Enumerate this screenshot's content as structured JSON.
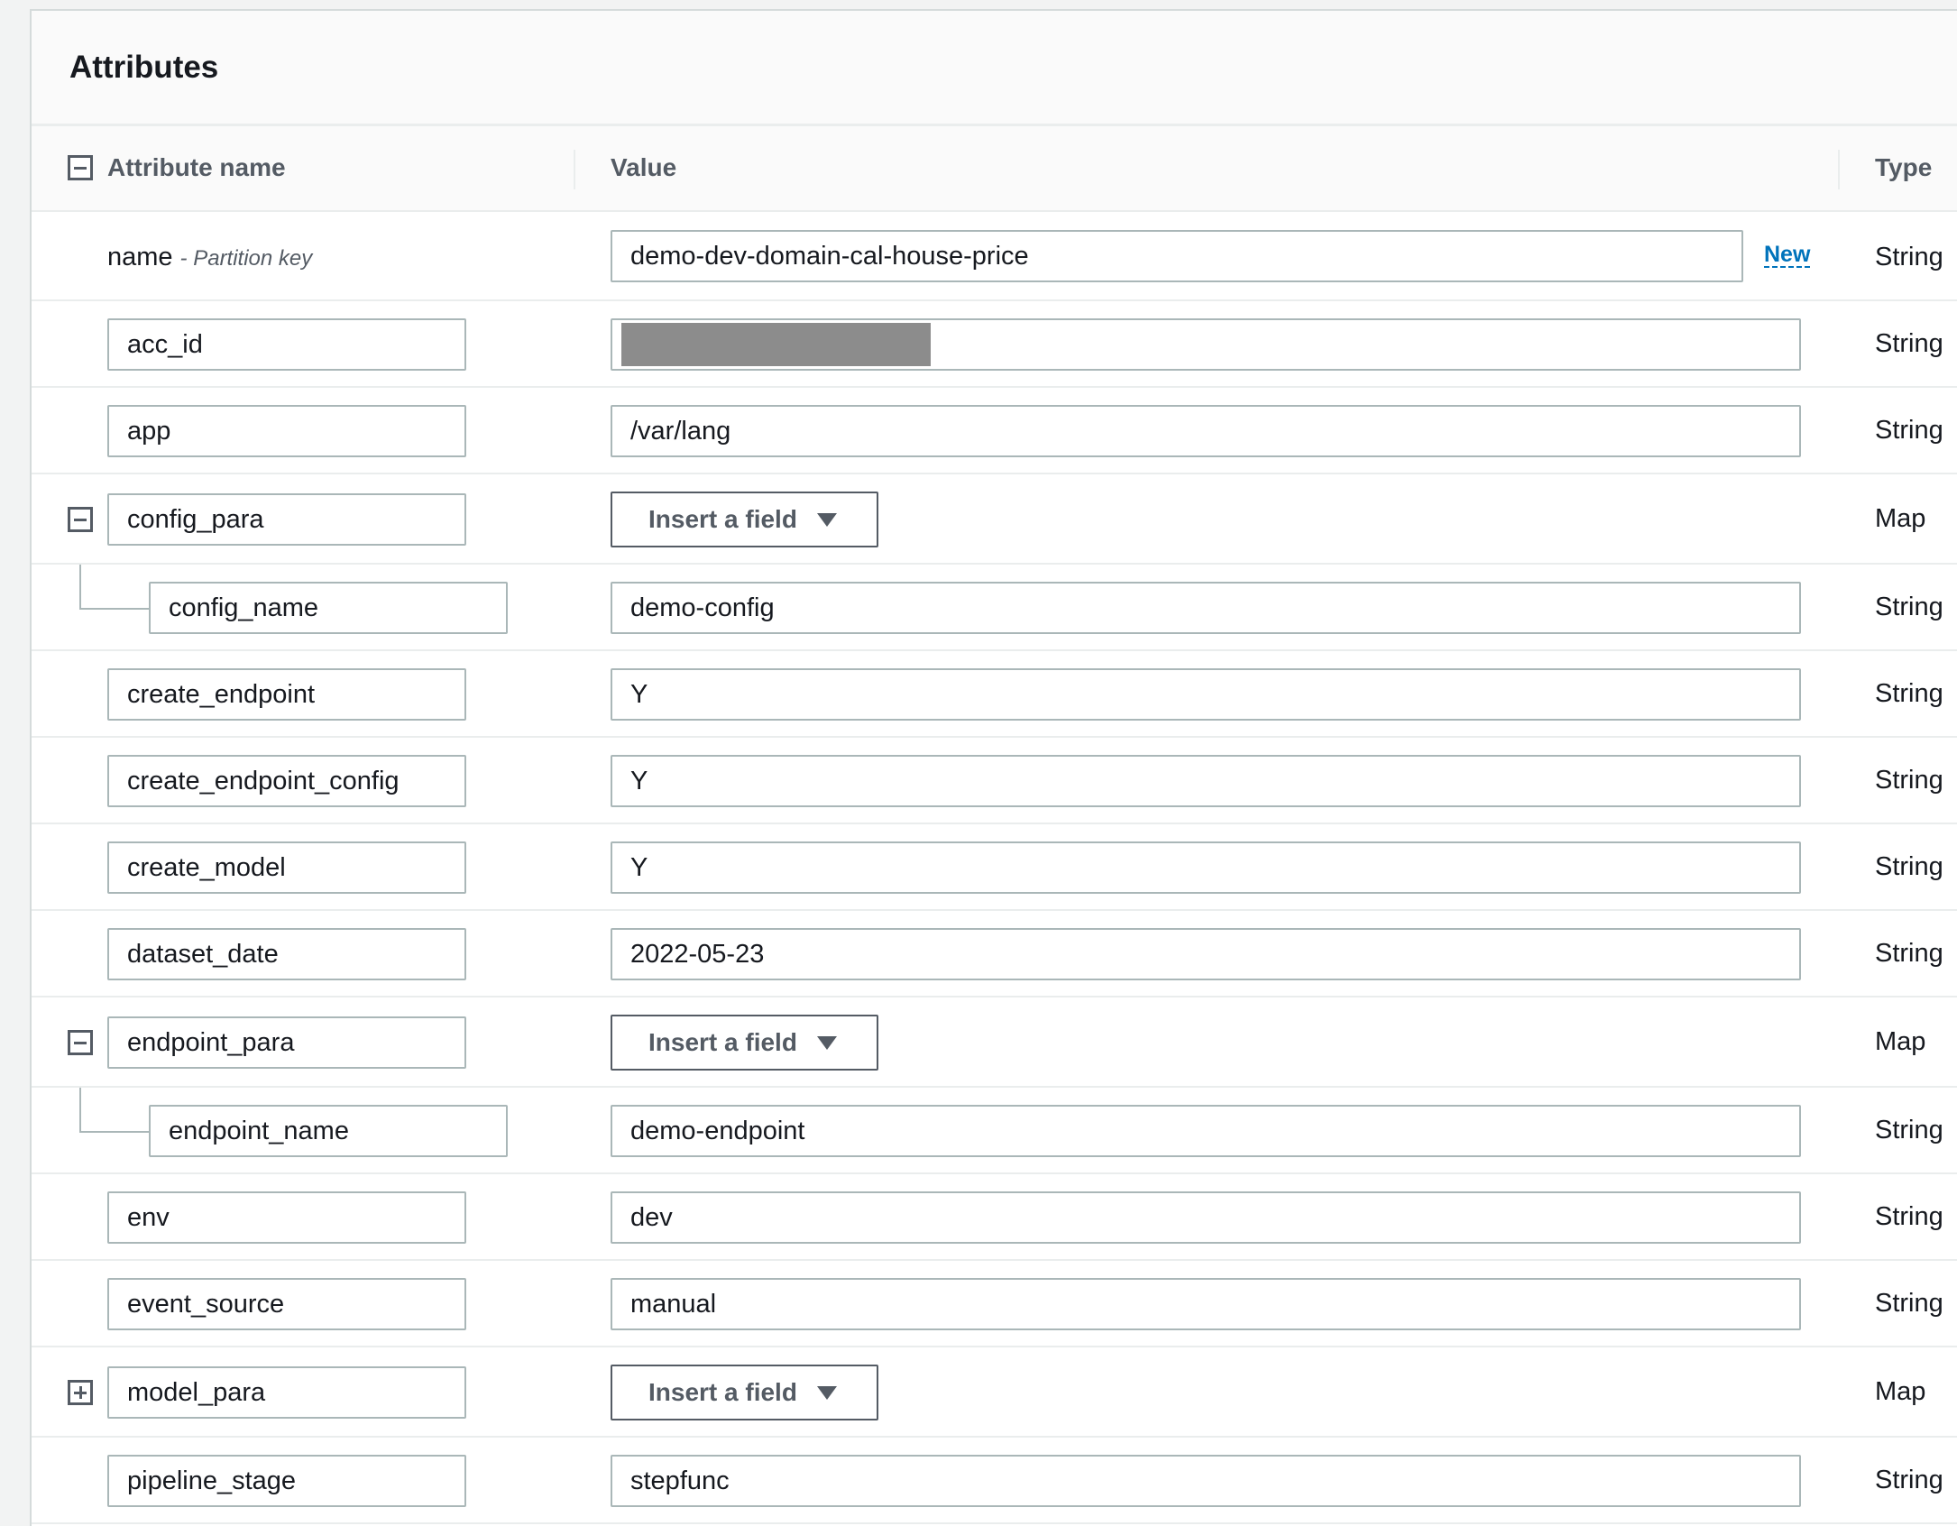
{
  "panel": {
    "title": "Attributes"
  },
  "columns": {
    "name": "Attribute name",
    "value": "Value",
    "type": "Type"
  },
  "partition": {
    "name": "name",
    "hint": "- Partition key",
    "value": "demo-dev-domain-cal-house-price",
    "new_label": "New",
    "type": "String"
  },
  "insert_label": "Insert a field",
  "rows": [
    {
      "name": "acc_id",
      "value": "",
      "type": "String",
      "redacted": true
    },
    {
      "name": "app",
      "value": "/var/lang",
      "type": "String"
    },
    {
      "name": "config_para",
      "type": "Map",
      "toggle": "collapse"
    },
    {
      "name": "config_name",
      "value": "demo-config",
      "type": "String",
      "child": true
    },
    {
      "name": "create_endpoint",
      "value": "Y",
      "type": "String"
    },
    {
      "name": "create_endpoint_config",
      "value": "Y",
      "type": "String"
    },
    {
      "name": "create_model",
      "value": "Y",
      "type": "String"
    },
    {
      "name": "dataset_date",
      "value": "2022-05-23",
      "type": "String"
    },
    {
      "name": "endpoint_para",
      "type": "Map",
      "toggle": "collapse"
    },
    {
      "name": "endpoint_name",
      "value": "demo-endpoint",
      "type": "String",
      "child": true
    },
    {
      "name": "env",
      "value": "dev",
      "type": "String"
    },
    {
      "name": "event_source",
      "value": "manual",
      "type": "String"
    },
    {
      "name": "model_para",
      "type": "Map",
      "toggle": "expand"
    },
    {
      "name": "pipeline_stage",
      "value": "stepfunc",
      "type": "String"
    }
  ]
}
